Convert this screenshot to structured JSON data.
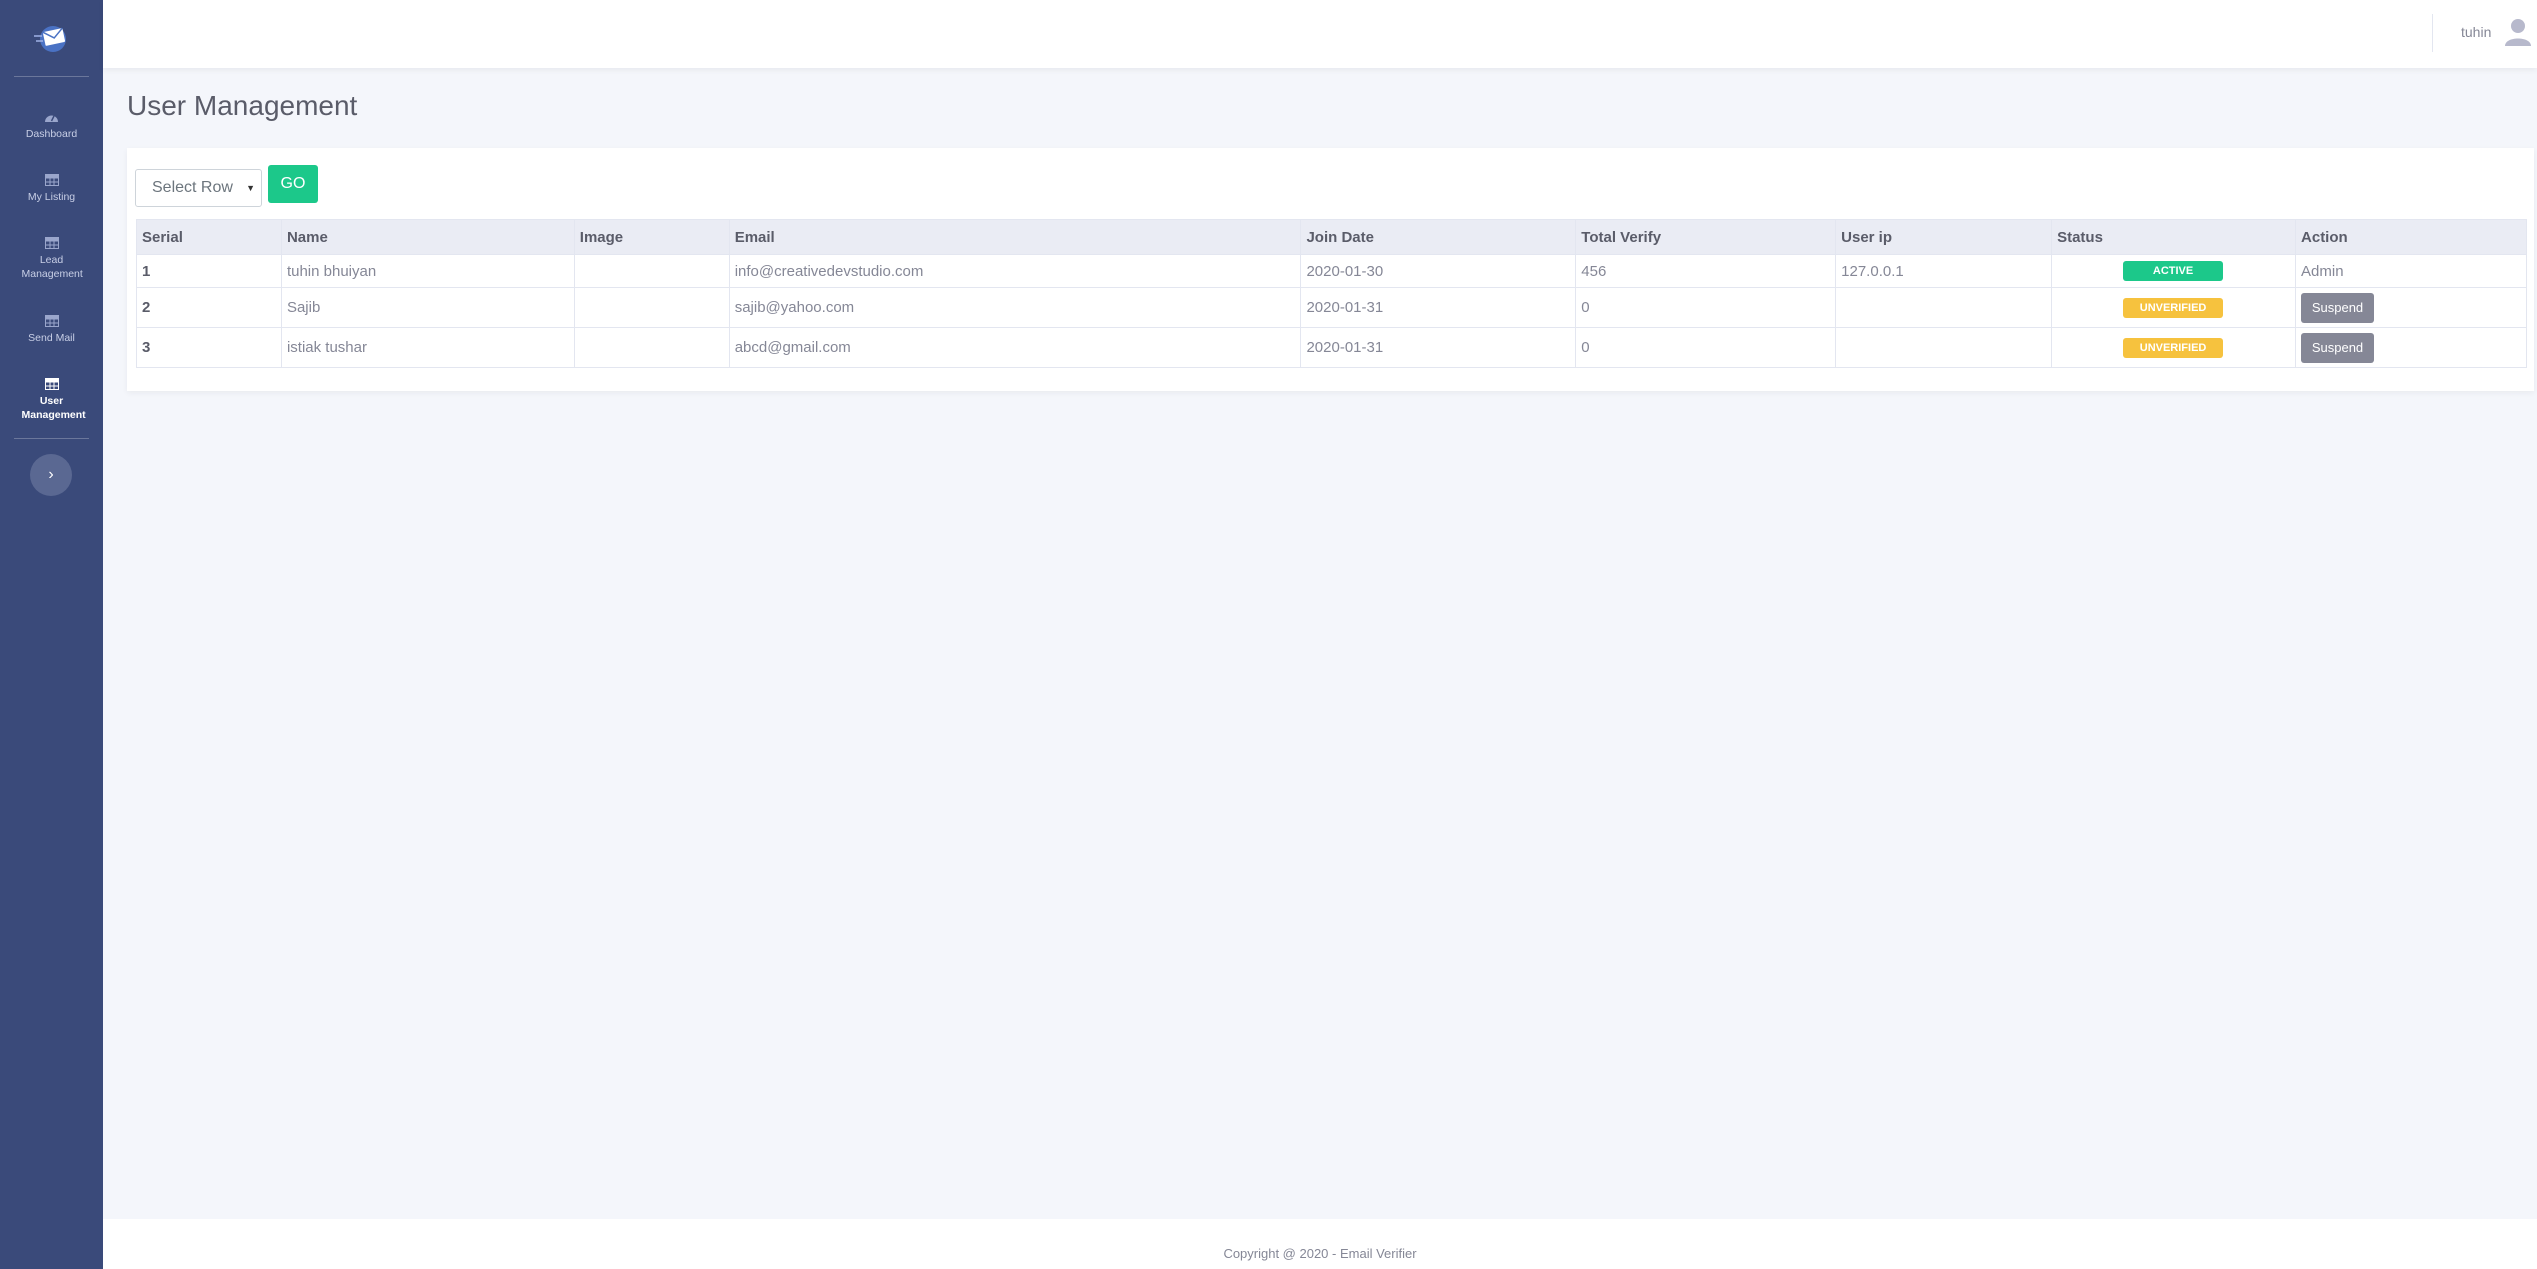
{
  "sidebar": {
    "items": [
      {
        "label": "Dashboard",
        "icon": "dashboard-icon"
      },
      {
        "label": "My Listing",
        "icon": "table-icon"
      },
      {
        "label": "Lead Management",
        "icon": "table-icon"
      },
      {
        "label": "Send Mail",
        "icon": "table-icon"
      },
      {
        "label": "User Management",
        "icon": "table-icon"
      }
    ],
    "toggle_glyph": "›"
  },
  "header": {
    "user_name": "tuhin"
  },
  "main": {
    "title": "User Management",
    "select_placeholder": "Select Row",
    "go_label": "GO",
    "table": {
      "columns": [
        "Serial",
        "Name",
        "Image",
        "Email",
        "Join Date",
        "Total Verify",
        "User ip",
        "Status",
        "Action"
      ],
      "rows": [
        {
          "serial": "1",
          "name": "tuhin bhuiyan",
          "image": "",
          "email": "info@creativedevstudio.com",
          "join_date": "2020-01-30",
          "total_verify": "456",
          "user_ip": "127.0.0.1",
          "status": "ACTIVE",
          "action": "Admin"
        },
        {
          "serial": "2",
          "name": "Sajib",
          "image": "",
          "email": "sajib@yahoo.com",
          "join_date": "2020-01-31",
          "total_verify": "0",
          "user_ip": "",
          "status": "UNVERIFIED",
          "action": "Suspend"
        },
        {
          "serial": "3",
          "name": "istiak tushar",
          "image": "",
          "email": "abcd@gmail.com",
          "join_date": "2020-01-31",
          "total_verify": "0",
          "user_ip": "",
          "status": "UNVERIFIED",
          "action": "Suspend"
        }
      ]
    }
  },
  "footer": {
    "copyright": "Copyright @ 2020 - Email Verifier"
  },
  "colors": {
    "sidebar": "#3a4a7a",
    "success": "#1cc88a",
    "warning": "#f6c23e",
    "secondary": "#858796"
  }
}
